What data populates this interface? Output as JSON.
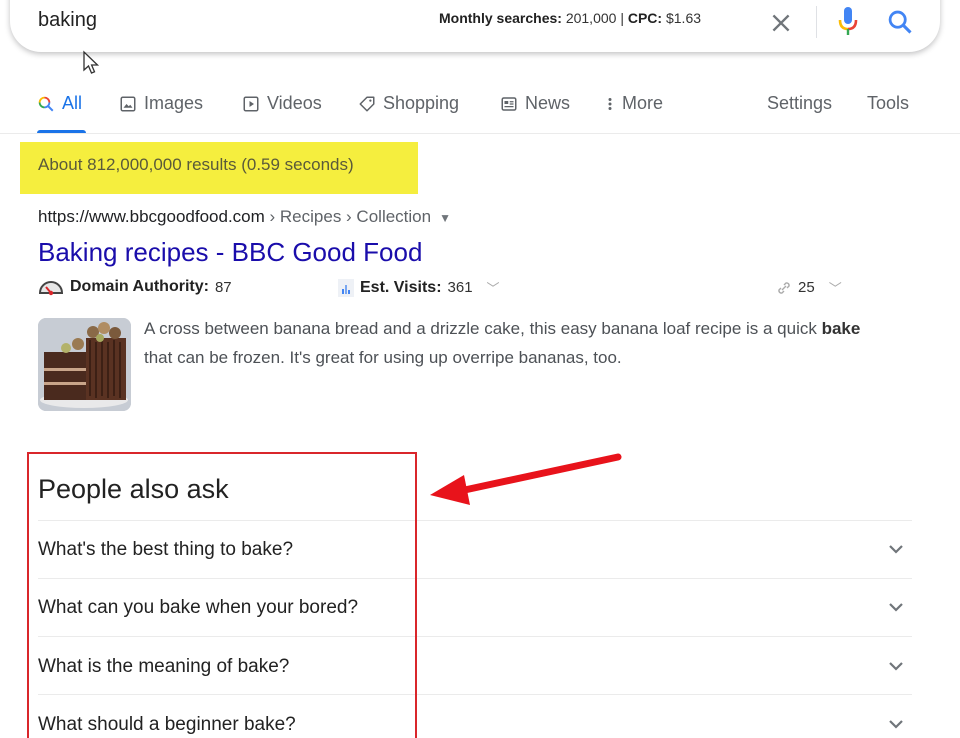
{
  "search": {
    "query": "baking",
    "metrics": {
      "monthly_label": "Monthly searches:",
      "monthly_value": "201,000",
      "separator": "|",
      "cpc_label": "CPC:",
      "cpc_value": "$1.63"
    },
    "icons": [
      "close-icon",
      "microphone-icon",
      "search-icon"
    ]
  },
  "tabs": [
    {
      "label": "All",
      "icon": "search-icon",
      "active": true
    },
    {
      "label": "Images",
      "icon": "image-icon"
    },
    {
      "label": "Videos",
      "icon": "play-icon"
    },
    {
      "label": "Shopping",
      "icon": "tag-icon"
    },
    {
      "label": "News",
      "icon": "news-icon"
    },
    {
      "label": "More",
      "icon": "more-vert-icon"
    },
    {
      "label": "Settings"
    },
    {
      "label": "Tools"
    }
  ],
  "stats": "About 812,000,000 results (0.59 seconds)",
  "highlight_color": "#f5ee3e",
  "result": {
    "url": "https://www.bbcgoodfood.com",
    "breadcrumb_rest": " › Recipes › Collection",
    "title": "Baking recipes - BBC Good Food",
    "domain_authority_label": "Domain Authority:",
    "domain_authority_value": "87",
    "est_visits_label": "Est. Visits:",
    "est_visits_value": "361",
    "links_value": "25",
    "snippet_pre": "A cross between banana bread and a drizzle cake, this easy banana loaf recipe is a quick ",
    "snippet_bold": "bake",
    "snippet_post": " that can be frozen. It's great for using up overripe bananas, too.",
    "thumbnail": "chocolate-cake-image"
  },
  "paa": {
    "title": "People also ask",
    "questions": [
      "What's the best thing to bake?",
      "What can you bake when your bored?",
      "What is the meaning of bake?",
      "What should a beginner bake?"
    ]
  },
  "annotation": {
    "box_color": "#d9262b",
    "arrow_color": "#e8131b"
  },
  "colors": {
    "link": "#1a0dab",
    "accent": "#1a73e8"
  }
}
